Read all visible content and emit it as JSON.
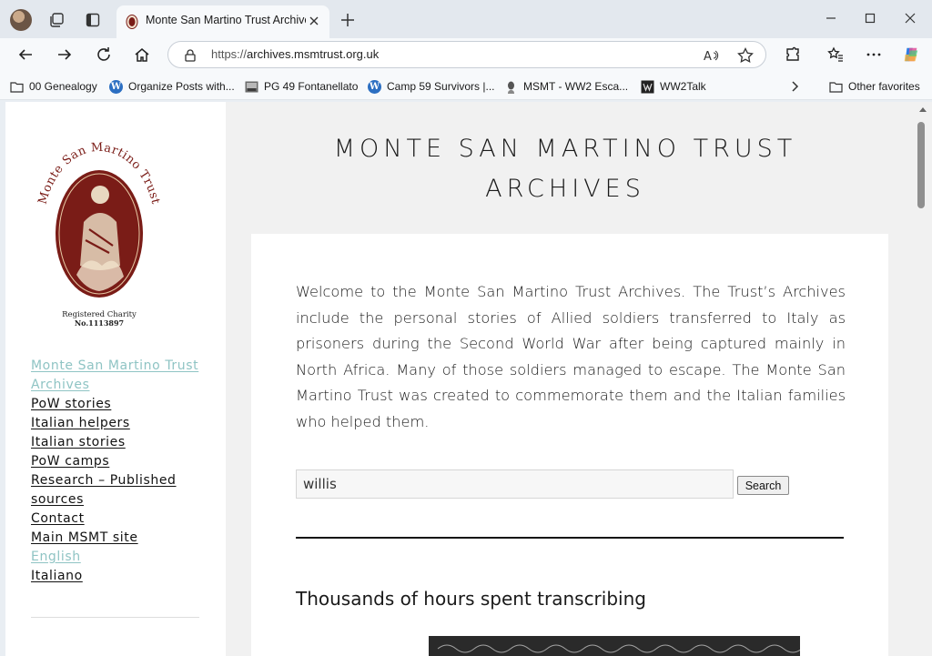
{
  "browser": {
    "tab_title": "Monte San Martino Trust Archives",
    "url_scheme": "https://",
    "url_host": "archives.msmtrust.org.uk"
  },
  "bookmarks": [
    {
      "label": "00 Genealogy",
      "icon": "folder-icon"
    },
    {
      "label": "Organize Posts with...",
      "icon": "wordpress-icon"
    },
    {
      "label": "PG 49 Fontanellato",
      "icon": "photo-icon"
    },
    {
      "label": "Camp 59 Survivors |...",
      "icon": "wordpress-icon"
    },
    {
      "label": "MSMT - WW2 Esca...",
      "icon": "msmt-icon"
    },
    {
      "label": "WW2Talk",
      "icon": "ww2talk-icon"
    }
  ],
  "bookmarks_other": "Other favorites",
  "logo": {
    "arc_text": "Monte San Martino Trust",
    "charity_line1": "Registered Charity",
    "charity_line2": "No.1113897"
  },
  "sidebar": {
    "items": [
      {
        "label": "Monte San Martino Trust Archives",
        "current": true
      },
      {
        "label": "PoW stories"
      },
      {
        "label": "Italian helpers"
      },
      {
        "label": "Italian stories"
      },
      {
        "label": "PoW camps"
      },
      {
        "label": "Research – Published sources"
      },
      {
        "label": "Contact"
      },
      {
        "label": "Main MSMT site"
      },
      {
        "label": "English",
        "current": true
      },
      {
        "label": "Italiano"
      }
    ]
  },
  "site": {
    "title_line1": "MONTE SAN MARTINO TRUST",
    "title_line2": "ARCHIVES"
  },
  "main": {
    "intro": "Welcome to the Monte San Martino Trust Archives. The Trust’s Archives include the personal stories of Allied soldiers transferred to Italy as prisoners during the Second World War after being captured mainly in North Africa. Many of those soldiers managed to escape. The Monte San Martino Trust was created to commemorate them and the Italian families who helped them.",
    "search_value": "willis",
    "search_button": "Search",
    "section_heading": "Thousands of hours spent transcribing"
  },
  "colors": {
    "link": "#111111",
    "link_current": "#8fc4c4",
    "logo_red": "#7a1c17"
  }
}
